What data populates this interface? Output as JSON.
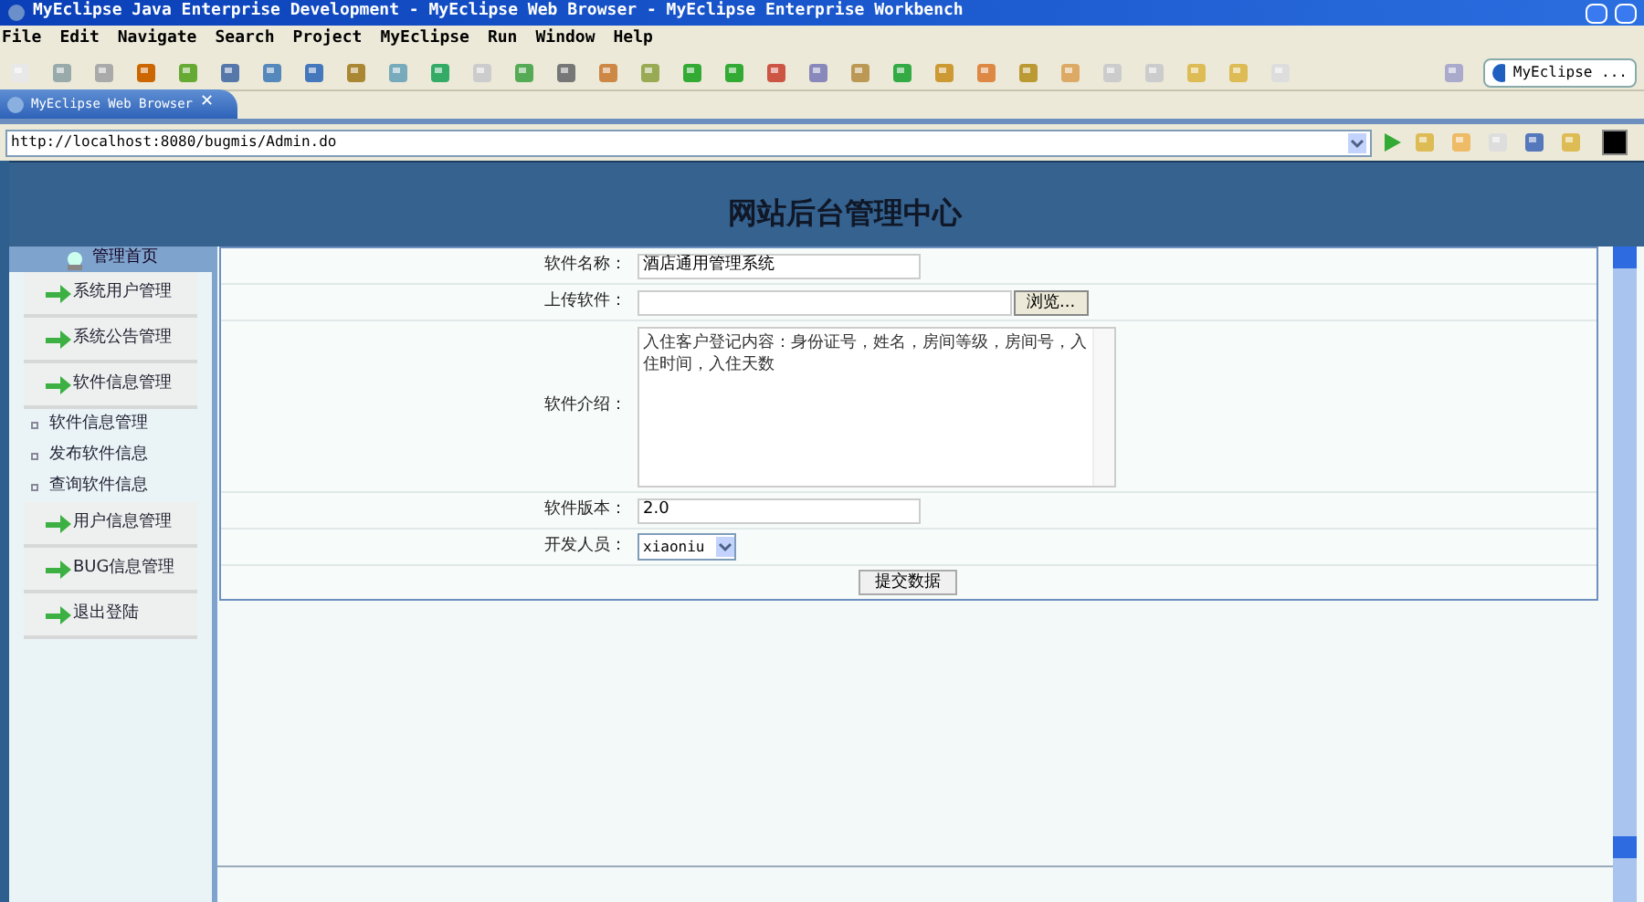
{
  "window": {
    "title": "MyEclipse Java Enterprise Development - MyEclipse Web Browser - MyEclipse Enterprise Workbench"
  },
  "menu": [
    "File",
    "Edit",
    "Navigate",
    "Search",
    "Project",
    "MyEclipse",
    "Run",
    "Window",
    "Help"
  ],
  "perspective": {
    "label": "MyEclipse ..."
  },
  "editor_tab": {
    "label": "MyEclipse Web Browser",
    "close": "✕"
  },
  "address": {
    "value": "http://localhost:8080/bugmis/Admin.do"
  },
  "page": {
    "title": "网站后台管理中心",
    "sidebar": {
      "home": "管理首页",
      "items": [
        {
          "kind": "section",
          "label": "系统用户管理"
        },
        {
          "kind": "section",
          "label": "系统公告管理"
        },
        {
          "kind": "section",
          "label": "软件信息管理"
        },
        {
          "kind": "link",
          "label": "软件信息管理"
        },
        {
          "kind": "link",
          "label": "发布软件信息"
        },
        {
          "kind": "link",
          "label": "查询软件信息"
        },
        {
          "kind": "section",
          "label": "用户信息管理"
        },
        {
          "kind": "section",
          "label": "BUG信息管理"
        },
        {
          "kind": "section",
          "label": "退出登陆"
        }
      ]
    },
    "form": {
      "rows": [
        {
          "kind": "text",
          "label": "软件名称：",
          "value": "酒店通用管理系统"
        },
        {
          "kind": "file",
          "label": "上传软件：",
          "button": "浏览..."
        },
        {
          "kind": "textarea",
          "label": "软件介绍：",
          "value": "入住客户登记内容：身份证号，姓名，房间等级，房间号，入住时间，入住天数"
        },
        {
          "kind": "text",
          "label": "软件版本：",
          "value": "2.0"
        },
        {
          "kind": "select",
          "label": "开发人员：",
          "value": "xiaoniu"
        }
      ],
      "submit": "提交数据"
    }
  }
}
